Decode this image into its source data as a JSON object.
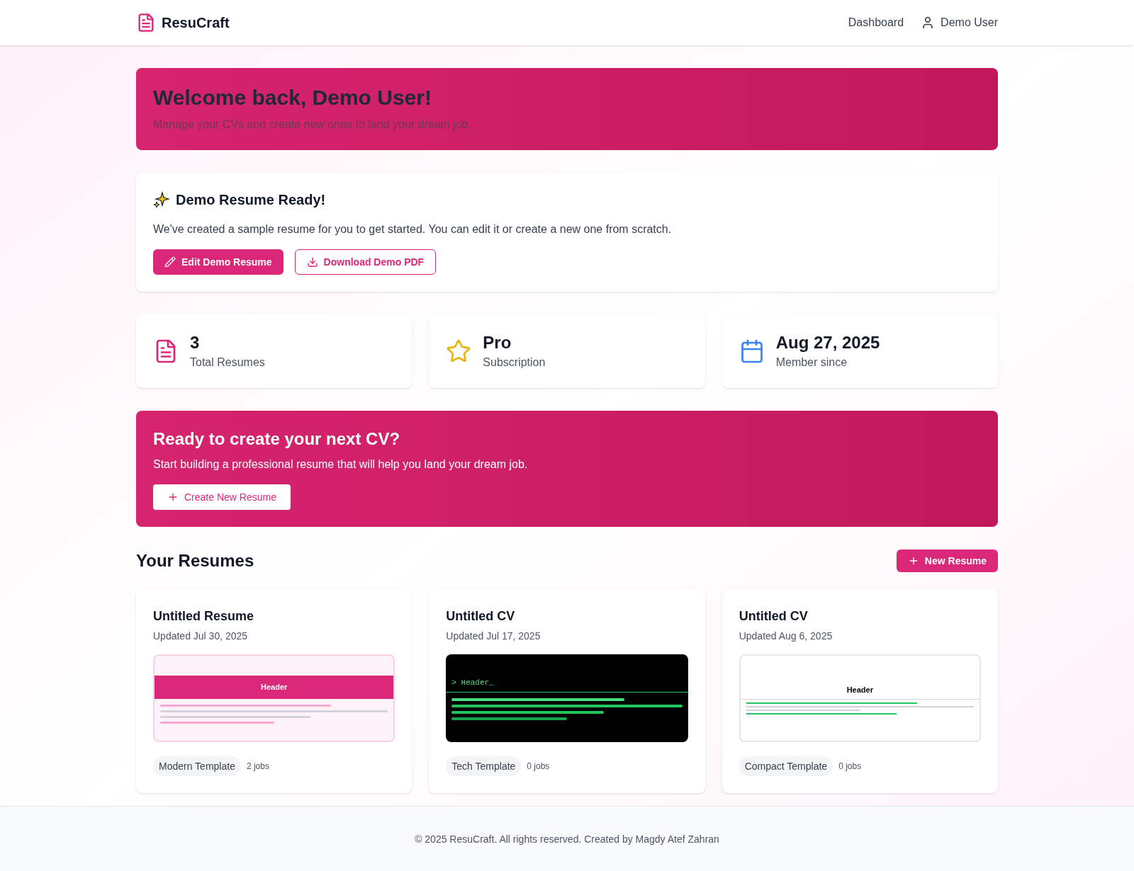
{
  "nav": {
    "brand": "ResuCraft",
    "links": [
      {
        "kind": "link",
        "label": "Dashboard"
      },
      {
        "kind": "user",
        "label": "Demo User"
      }
    ]
  },
  "welcome": {
    "title": "Welcome back, Demo User!",
    "subtitle": "Manage your CVs and create new ones to land your dream job."
  },
  "demo": {
    "title": "Demo Resume Ready!",
    "text": "We've created a sample resume for you to get started. You can edit it or create a new one from scratch.",
    "buttons": [
      {
        "kind": "edit",
        "label": "Edit Demo Resume"
      },
      {
        "kind": "download",
        "label": "Download Demo PDF"
      }
    ]
  },
  "stats": [
    {
      "kind": "document",
      "value": "3",
      "label": "Total Resumes"
    },
    {
      "kind": "star",
      "value": "Pro",
      "label": "Subscription"
    },
    {
      "kind": "calendar",
      "value": "Aug 27, 2025",
      "label": "Member since"
    }
  ],
  "cta": {
    "title": "Ready to create your next CV?",
    "text": "Start building a professional resume that will help you land your dream job.",
    "button": "Create New Resume"
  },
  "resumes": {
    "title": "Your Resumes",
    "button": "New Resume",
    "items": [
      {
        "title": "Untitled Resume",
        "updated": "Updated Jul 30, 2025",
        "preview": {
          "kind": "modern",
          "header": "Header"
        },
        "template": "Modern Template",
        "jobs": "2 jobs"
      },
      {
        "title": "Untitled CV",
        "updated": "Updated Jul 17, 2025",
        "preview": {
          "kind": "tech",
          "header": "> Header_"
        },
        "template": "Tech Template",
        "jobs": "0 jobs"
      },
      {
        "title": "Untitled CV",
        "updated": "Updated Aug 6, 2025",
        "preview": {
          "kind": "compact",
          "header": "Header"
        },
        "template": "Compact Template",
        "jobs": "0 jobs"
      }
    ]
  },
  "footer": "© 2025 ResuCraft. All rights reserved. Created by Magdy Atef Zahran"
}
